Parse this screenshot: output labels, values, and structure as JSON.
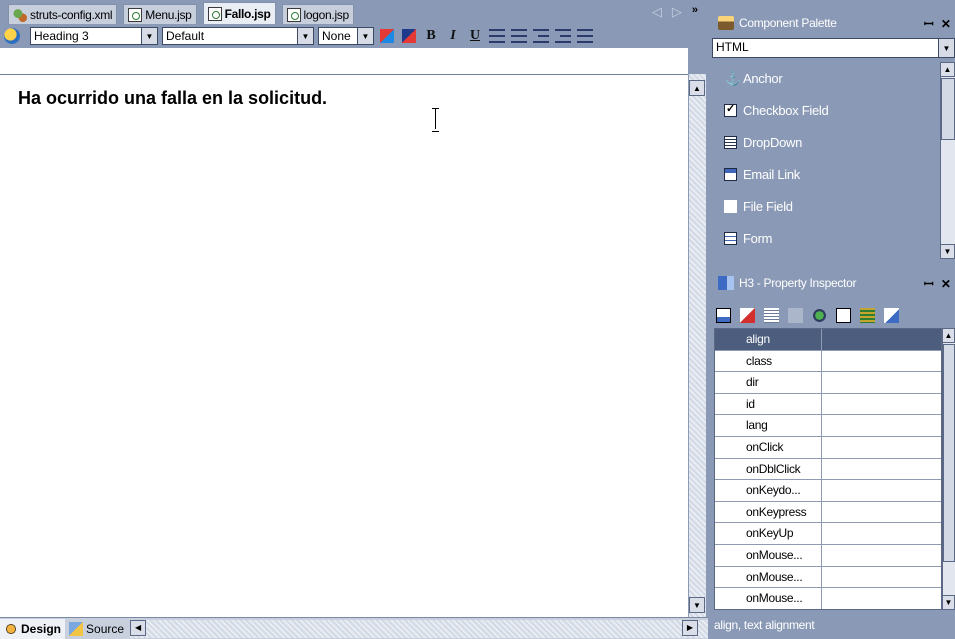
{
  "tabs": [
    {
      "label": "struts-config.xml",
      "icon": "xml-file-icon",
      "active": false
    },
    {
      "label": "Menu.jsp",
      "icon": "jsp-file-icon",
      "active": false
    },
    {
      "label": "Fallo.jsp",
      "icon": "jsp-file-icon",
      "active": true
    },
    {
      "label": "logon.jsp",
      "icon": "jsp-file-icon",
      "active": false
    }
  ],
  "nav": {
    "prev": "◁",
    "next": "▷",
    "more": "»"
  },
  "format_bar": {
    "block_format": "Heading 3",
    "font": "Default",
    "size": "None",
    "bold": "B",
    "italic": "I",
    "underline": "U"
  },
  "document": {
    "heading": "Ha ocurrido una falla en la solicitud."
  },
  "views": {
    "design": "Design",
    "source": "Source"
  },
  "palette": {
    "title": "Component Palette",
    "controls": "ꟷ ✕",
    "category": "HTML",
    "items": [
      {
        "label": "Anchor",
        "icon": "anchor-icon"
      },
      {
        "label": "Checkbox Field",
        "icon": "checkbox-icon"
      },
      {
        "label": "DropDown",
        "icon": "dropdown-icon"
      },
      {
        "label": "Email Link",
        "icon": "email-icon"
      },
      {
        "label": "File Field",
        "icon": "file-icon"
      },
      {
        "label": "Form",
        "icon": "form-icon"
      }
    ]
  },
  "inspector": {
    "title": "H3 - Property Inspector",
    "controls": "ꟷ ✕",
    "properties": [
      {
        "name": "align",
        "value": ""
      },
      {
        "name": "class",
        "value": ""
      },
      {
        "name": "dir",
        "value": ""
      },
      {
        "name": "id",
        "value": ""
      },
      {
        "name": "lang",
        "value": ""
      },
      {
        "name": "onClick",
        "value": ""
      },
      {
        "name": "onDblClick",
        "value": ""
      },
      {
        "name": "onKeydo...",
        "value": ""
      },
      {
        "name": "onKeypress",
        "value": ""
      },
      {
        "name": "onKeyUp",
        "value": ""
      },
      {
        "name": "onMouse...",
        "value": ""
      },
      {
        "name": "onMouse...",
        "value": ""
      },
      {
        "name": "onMouse...",
        "value": ""
      }
    ],
    "status": "align, text alignment"
  }
}
